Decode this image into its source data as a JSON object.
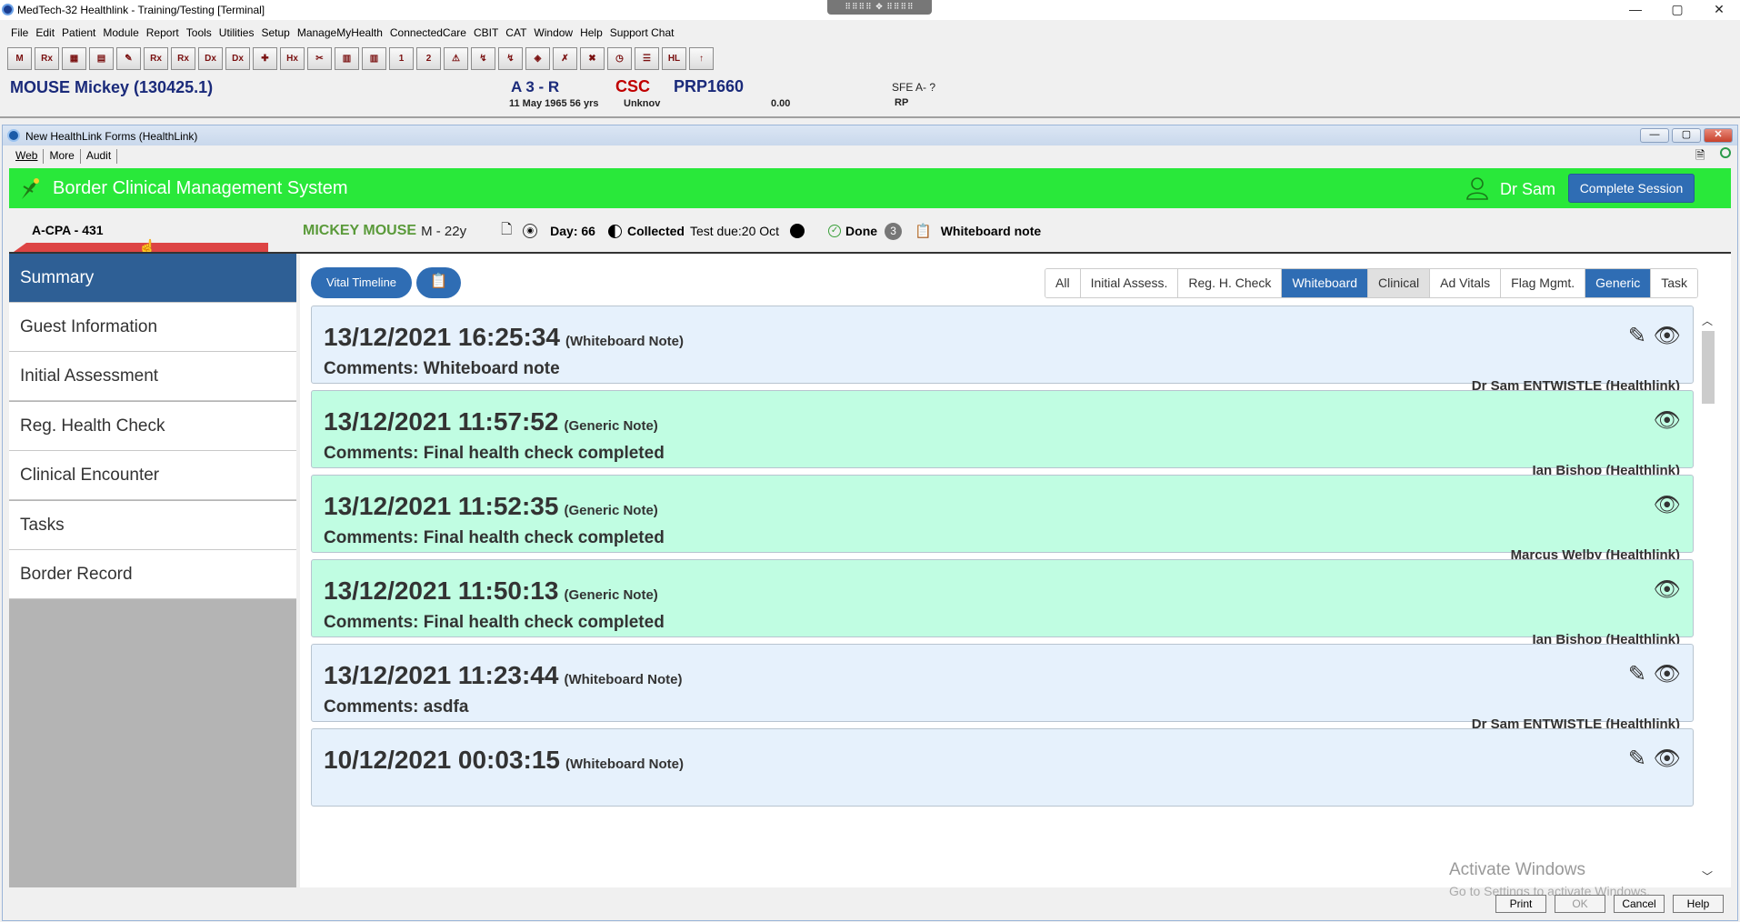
{
  "window": {
    "title": "MedTech-32  Healthlink - Training/Testing  [Terminal]",
    "grip_label": "⠿⠿⠿⠿ ✥ ⠿⠿⠿⠿",
    "controls": [
      "—",
      "▢",
      "✕"
    ]
  },
  "menu": [
    "File",
    "Edit",
    "Patient",
    "Module",
    "Report",
    "Tools",
    "Utilities",
    "Setup",
    "ManageMyHealth",
    "ConnectedCare",
    "CBIT",
    "CAT",
    "Window",
    "Help",
    "Support Chat"
  ],
  "toolbar_icons": [
    "M",
    "Rx",
    "▦",
    "▤",
    "✎",
    "Rx",
    "Rx",
    "Dx",
    "Dx",
    "✚",
    "Hx",
    "✂",
    "▥",
    "▥",
    "1",
    "2",
    "⚠",
    "↯",
    "↯",
    "◈",
    "✗",
    "✖",
    "◷",
    "☰",
    "HL",
    "↑"
  ],
  "patient_banner": {
    "name": "MOUSE Mickey (130425.1)",
    "nhi": "A 3 - R",
    "dob": "11 May 1965 56 yrs",
    "csc": "CSC",
    "unknown": "Unknov",
    "prp": "PRP1660",
    "balance": "0.00",
    "sfe": "SFE A- ?",
    "rp": "RP"
  },
  "inner_window": {
    "title": "New HealthLink Forms (HealthLink)",
    "controls": [
      "—",
      "▢",
      "✕"
    ],
    "tabs": [
      "Web",
      "More",
      "Audit"
    ]
  },
  "app": {
    "title": "Border Clinical Management System",
    "user": "Dr Sam",
    "complete_session": "Complete Session"
  },
  "case": {
    "id": "A-CPA - 431",
    "patient": "MICKEY MOUSE",
    "sex_age": "M - 22y",
    "day": "Day: 66",
    "collected": "Collected",
    "test_due": "Test due:20 Oct",
    "done": "Done",
    "done_count": "3",
    "whiteboard_note": "Whiteboard note"
  },
  "sidebar": {
    "items": [
      {
        "label": "Summary",
        "active": true
      },
      {
        "label": "Guest Information"
      },
      {
        "label": "Initial Assessment"
      },
      {
        "label": "Reg. Health Check"
      },
      {
        "label": "Clinical Encounter"
      },
      {
        "label": "Tasks"
      },
      {
        "label": "Border Record"
      }
    ]
  },
  "main": {
    "vital_timeline": "Vital Timeline",
    "clip_button": "📋",
    "filters": [
      {
        "label": "All"
      },
      {
        "label": "Initial Assess."
      },
      {
        "label": "Reg. H. Check"
      },
      {
        "label": "Whiteboard",
        "state": "on"
      },
      {
        "label": "Clinical",
        "state": "grey"
      },
      {
        "label": "Ad Vitals"
      },
      {
        "label": "Flag Mgmt."
      },
      {
        "label": "Generic",
        "state": "on"
      },
      {
        "label": "Task"
      }
    ],
    "notes": [
      {
        "timestamp": "13/12/2021 16:25:34",
        "type": "(Whiteboard Note)",
        "comment": "Comments: Whiteboard note",
        "author": "Dr Sam ENTWISTLE (Healthlink)",
        "kind": "whiteboard",
        "editable": true
      },
      {
        "timestamp": "13/12/2021 11:57:52",
        "type": "(Generic Note)",
        "comment": "Comments: Final health check completed",
        "author": "Ian Bishop (Healthlink)",
        "kind": "generic",
        "editable": false
      },
      {
        "timestamp": "13/12/2021 11:52:35",
        "type": "(Generic Note)",
        "comment": "Comments: Final health check completed",
        "author": "Marcus Welby (Healthlink)",
        "kind": "generic",
        "editable": false
      },
      {
        "timestamp": "13/12/2021 11:50:13",
        "type": "(Generic Note)",
        "comment": "Comments: Final health check completed",
        "author": "Ian Bishop (Healthlink)",
        "kind": "generic",
        "editable": false
      },
      {
        "timestamp": "13/12/2021 11:23:44",
        "type": "(Whiteboard Note)",
        "comment": "Comments: asdfa",
        "author": "Dr Sam ENTWISTLE (Healthlink)",
        "kind": "whiteboard",
        "editable": true
      },
      {
        "timestamp": "10/12/2021 00:03:15",
        "type": "(Whiteboard Note)",
        "comment": "",
        "author": "",
        "kind": "whiteboard",
        "editable": true
      }
    ]
  },
  "watermark": {
    "line1": "Activate Windows",
    "line2": "Go to Settings to activate Windows."
  },
  "bottom_buttons": [
    {
      "label": "Print"
    },
    {
      "label": "OK",
      "disabled": true
    },
    {
      "label": "Cancel"
    },
    {
      "label": "Help"
    }
  ],
  "colors": {
    "app_green": "#29e83a",
    "primary_blue": "#2f6db4",
    "sidebar_active": "#2e5f95",
    "whiteboard_bg": "#e6f1fc",
    "generic_bg": "#c0fde2"
  }
}
